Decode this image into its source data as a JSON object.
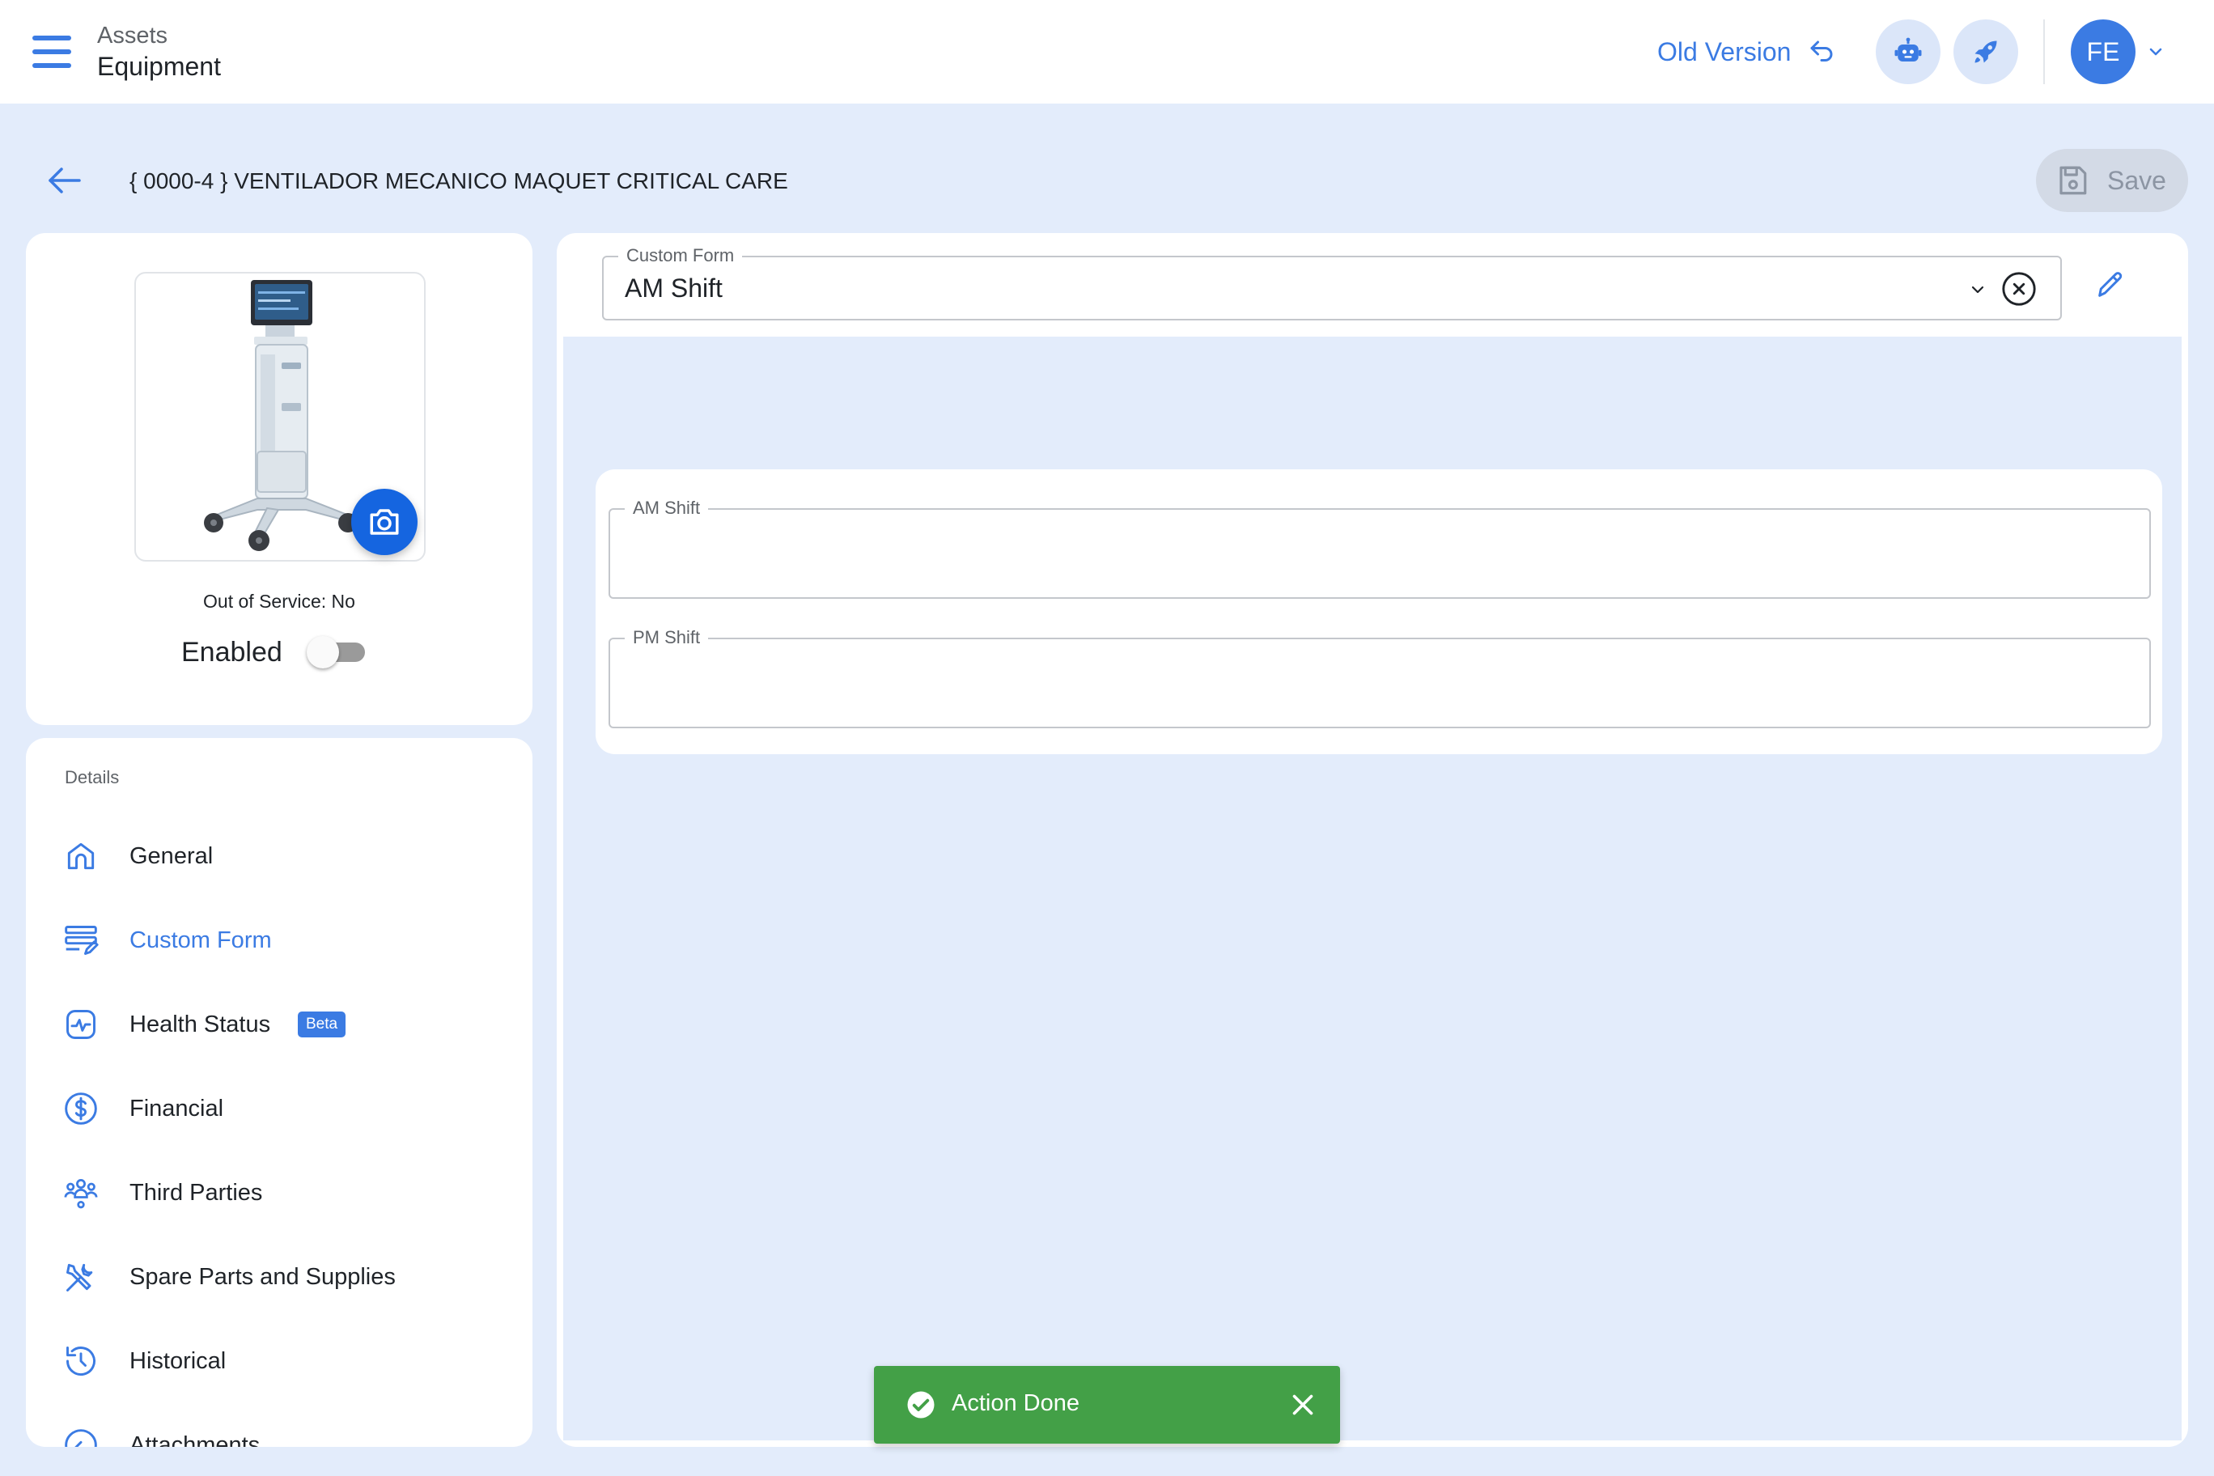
{
  "header": {
    "breadcrumb_parent": "Assets",
    "breadcrumb_current": "Equipment",
    "old_version_label": "Old Version",
    "user_initials": "FE"
  },
  "page": {
    "title": "{ 0000-4 } VENTILADOR MECANICO MAQUET CRITICAL CARE",
    "save_label": "Save"
  },
  "equipment_card": {
    "out_of_service_text": "Out of Service: No",
    "enabled_label": "Enabled",
    "enabled": false
  },
  "details_menu": {
    "section_label": "Details",
    "items": [
      {
        "label": "General",
        "icon": "home-icon",
        "active": false
      },
      {
        "label": "Custom Form",
        "icon": "form-icon",
        "active": true
      },
      {
        "label": "Health Status",
        "icon": "health-monitor-icon",
        "active": false,
        "badge": "Beta"
      },
      {
        "label": "Financial",
        "icon": "dollar-icon",
        "active": false
      },
      {
        "label": "Third Parties",
        "icon": "people-icon",
        "active": false
      },
      {
        "label": "Spare Parts and Supplies",
        "icon": "tools-icon",
        "active": false
      },
      {
        "label": "Historical",
        "icon": "history-icon",
        "active": false
      },
      {
        "label": "Attachments",
        "icon": "attachment-icon",
        "active": false
      }
    ]
  },
  "custom_form": {
    "select_label": "Custom Form",
    "selected_value": "AM Shift",
    "fields": [
      {
        "label": "AM Shift",
        "value": ""
      },
      {
        "label": "PM Shift",
        "value": ""
      }
    ]
  },
  "snackbar": {
    "message": "Action Done"
  },
  "colors": {
    "accent": "#3b7be3",
    "background": "#e3ecfb",
    "success": "#43a047",
    "camera_button": "#1565e0"
  }
}
